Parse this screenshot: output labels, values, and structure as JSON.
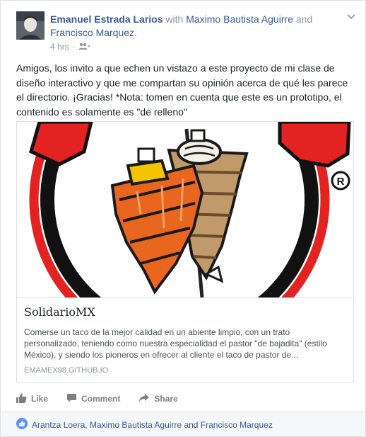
{
  "post": {
    "author": "Emanuel Estrada Larios",
    "with_word": "with",
    "tag1": "Maximo Bautista Aguirre",
    "and_word": "and",
    "tag2": "Francisco Marquez.",
    "time": "4 hrs",
    "dot": "·",
    "text": "Amigos, los invito a que echen un vistazo a este proyecto de mi clase de diseño interactivo y que me compartan su opinión acerca de qué les parece el directorio. ¡Gracias! *Nota: tomen en cuenta que este es un prototipo, el contenido es solamente es \"de relleno\""
  },
  "link_card": {
    "title": "SolidarioMX",
    "description": "Comerse un taco de la mejor calidad en un abiente limpio, con un trato personalizado, teniendo como nuestra especialidad el pastor \"de bajadita\" (estilo México), y siendo los pioneros en ofrecer al cliente el taco de pastor de...",
    "url": "EMAMEX98.GITHUB.IO",
    "image_icon": "trompo-logo",
    "registered_mark": "R"
  },
  "actions": {
    "like": "Like",
    "comment": "Comment",
    "share": "Share"
  },
  "likes": {
    "text": "Arantza Loera, Maximo Bautista Aguirre and Francisco Marquez"
  },
  "colors": {
    "link": "#365899",
    "meta": "#90949c",
    "logo_red": "#e32222",
    "trompo_orange": "#e8661e",
    "trompo_tan": "#c09a6a"
  }
}
